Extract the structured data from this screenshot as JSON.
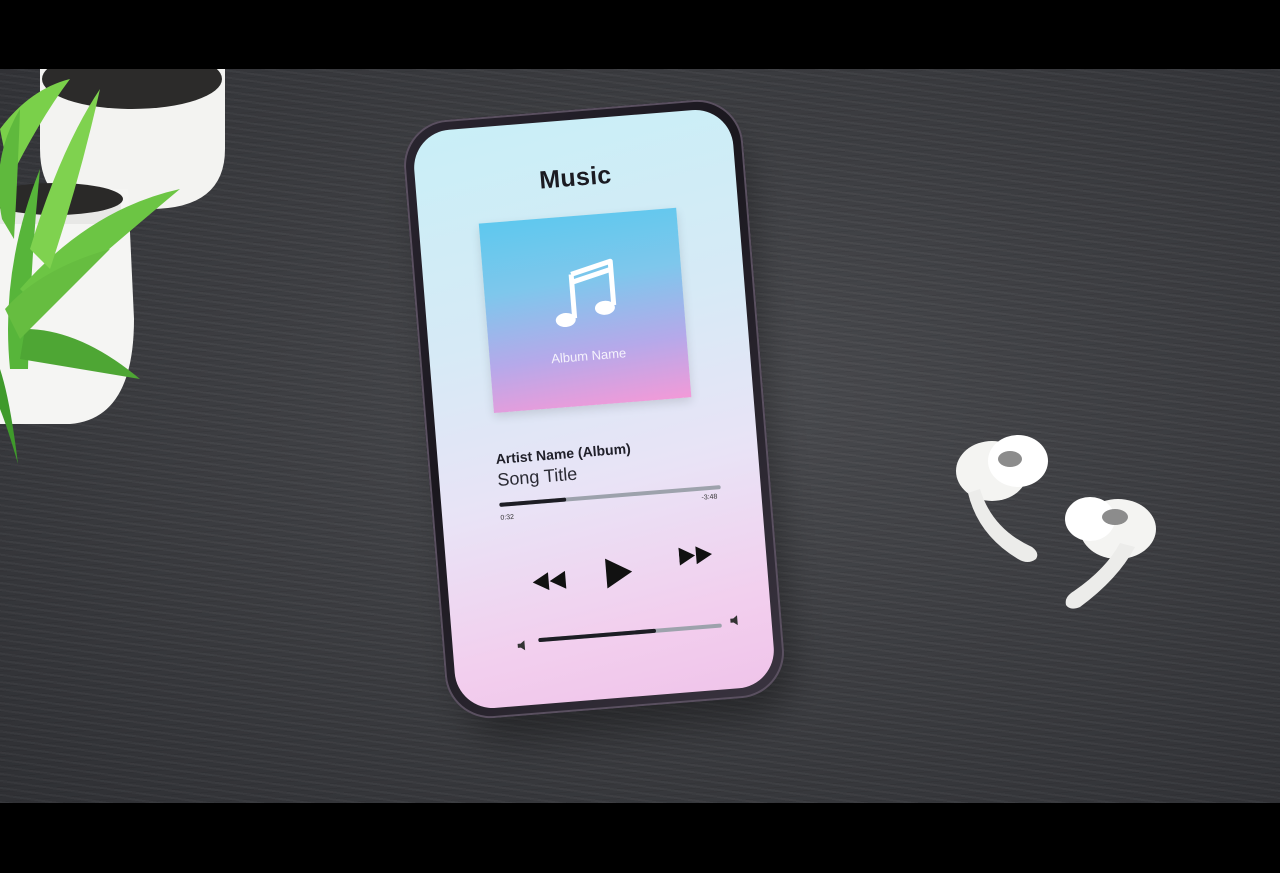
{
  "scene": {
    "background_color": "#3d3e42",
    "letterbox_color": "#000000"
  },
  "phone": {
    "app_title": "Music",
    "album_art": {
      "icon": "music-note-icon",
      "label": "Album Name",
      "gradient": [
        "#5ec8ee",
        "#f29ad8"
      ]
    },
    "now_playing": {
      "artist_line": "Artist Name (Album)",
      "song_title": "Song Title",
      "time_elapsed": "0:32",
      "time_remaining": "-3:48",
      "progress_fraction": 0.3
    },
    "controls": {
      "rewind": "rewind-icon",
      "play": "play-icon",
      "fast_forward": "fast-forward-icon"
    },
    "volume": {
      "level_fraction": 0.64,
      "low_icon": "volume-low-icon",
      "high_icon": "volume-high-icon"
    }
  },
  "objects": {
    "plant": "potted-plant",
    "earbuds": "wireless-earbuds"
  }
}
